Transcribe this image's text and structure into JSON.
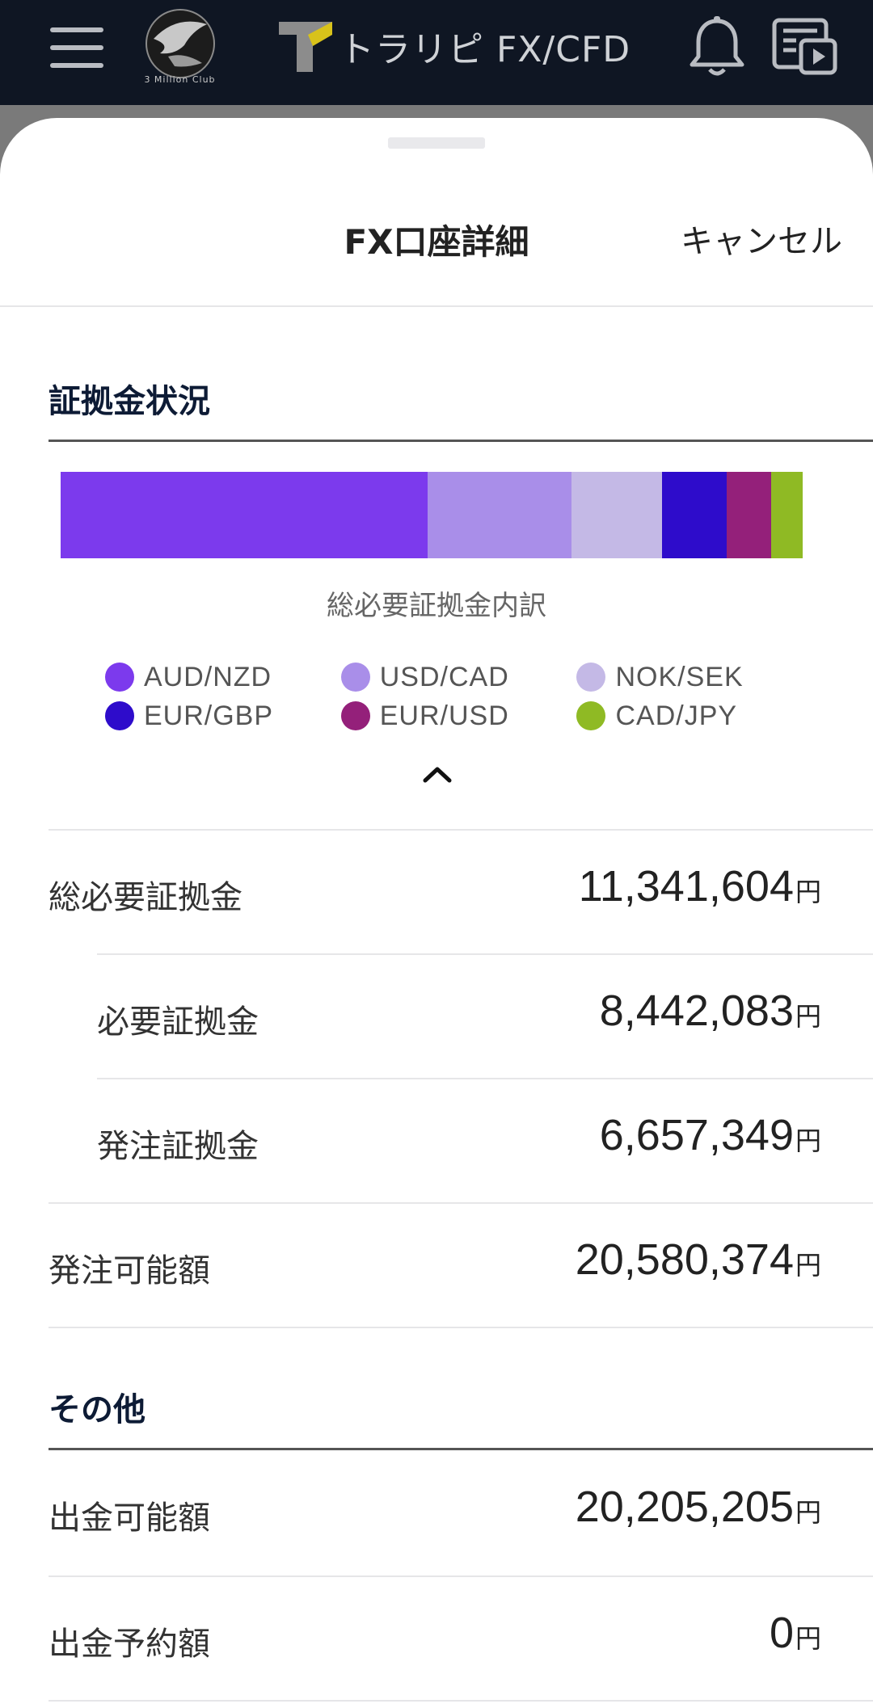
{
  "topbar": {
    "club_logo_text": "3 Million Club",
    "brand_name": "トラリピ FX/CFD"
  },
  "sheet": {
    "title": "FX口座詳細",
    "cancel_label": "キャンセル"
  },
  "margin_section": {
    "title": "証拠金状況",
    "chart_caption": "総必要証拠金内訳",
    "legend": [
      {
        "label": "AUD/NZD",
        "color": "#7c3aed"
      },
      {
        "label": "USD/CAD",
        "color": "#a98ee9"
      },
      {
        "label": "NOK/SEK",
        "color": "#c4b9e6"
      },
      {
        "label": "EUR/GBP",
        "color": "#2e0ccb"
      },
      {
        "label": "EUR/USD",
        "color": "#94207a"
      },
      {
        "label": "CAD/JPY",
        "color": "#8fba24"
      }
    ]
  },
  "chart_data": {
    "type": "bar",
    "title": "総必要証拠金内訳",
    "stacked": true,
    "orientation": "horizontal",
    "categories": [
      "AUD/NZD",
      "USD/CAD",
      "NOK/SEK",
      "EUR/GBP",
      "EUR/USD",
      "CAD/JPY"
    ],
    "values_share_percent": [
      49.5,
      19.3,
      12.2,
      8.8,
      5.9,
      4.3
    ],
    "colors": [
      "#7c3aed",
      "#a98ee9",
      "#c4b9e6",
      "#2e0ccb",
      "#94207a",
      "#8fba24"
    ]
  },
  "rows": [
    {
      "label": "総必要証拠金",
      "value": "11,341,604",
      "unit": "円"
    },
    {
      "label": "必要証拠金",
      "value": "8,442,083",
      "unit": "円"
    },
    {
      "label": "発注証拠金",
      "value": "6,657,349",
      "unit": "円"
    },
    {
      "label": "発注可能額",
      "value": "20,580,374",
      "unit": "円"
    }
  ],
  "other_section": {
    "title": "その他"
  },
  "other_rows": [
    {
      "label": "出金可能額",
      "value": "20,205,205",
      "unit": "円"
    },
    {
      "label": "出金予約額",
      "value": "0",
      "unit": "円"
    }
  ]
}
